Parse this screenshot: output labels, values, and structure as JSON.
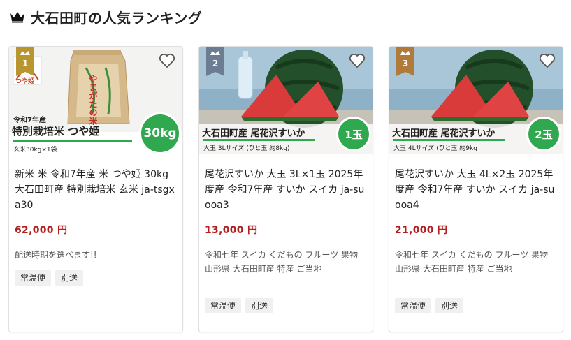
{
  "page": {
    "title": "大石田町の人気ランキング",
    "icons": {
      "crown": "crown-icon",
      "favorite": "heart-icon"
    }
  },
  "colors": {
    "price": "#b21e1e",
    "rank1": "#b8952e",
    "rank2": "#6b7c93",
    "rank3": "#b07a3a",
    "badge_green": "#2fa84f"
  },
  "items": [
    {
      "rank": "1",
      "image": {
        "tag": "つや姫",
        "bag_text": "やまがたの米",
        "year_text": "令和7年産",
        "title": "特別栽培米 つや姫",
        "subtitle": "玄米30kg×1袋",
        "badge": "30kg"
      },
      "name": "新米 米 令和7年産 米 つや姫 30kg 大石田町産 特別栽培米 玄米 ja-tsgxa30",
      "price": "62,000 円",
      "description": "配送時期を選べます!!",
      "tags": [
        "常温便",
        "別送"
      ]
    },
    {
      "rank": "2",
      "image": {
        "title": "大石田町産 尾花沢すいか",
        "subtitle": "大玉 3Lサイズ (ひと玉 約8kg)",
        "badge": "1玉"
      },
      "name": "尾花沢すいか 大玉 3L×1玉 2025年度産 令和7年産 すいか スイカ ja-suooa3",
      "price": "13,000 円",
      "description": "令和七年 スイカ くだもの フルーツ 果物 山形県 大石田町産 特産 ご当地",
      "tags": [
        "常温便",
        "別送"
      ]
    },
    {
      "rank": "3",
      "image": {
        "title": "大石田町産 尾花沢すいか",
        "subtitle": "大玉 4Lサイズ (ひと玉 約9kg",
        "badge": "2玉"
      },
      "name": "尾花沢すいか 大玉 4L×2玉 2025年度産 令和7年産 すいか スイカ ja-suooa4",
      "price": "21,000 円",
      "description": "令和七年 スイカ くだもの フルーツ 果物 山形県 大石田町産 特産 ご当地",
      "tags": [
        "常温便",
        "別送"
      ]
    }
  ]
}
